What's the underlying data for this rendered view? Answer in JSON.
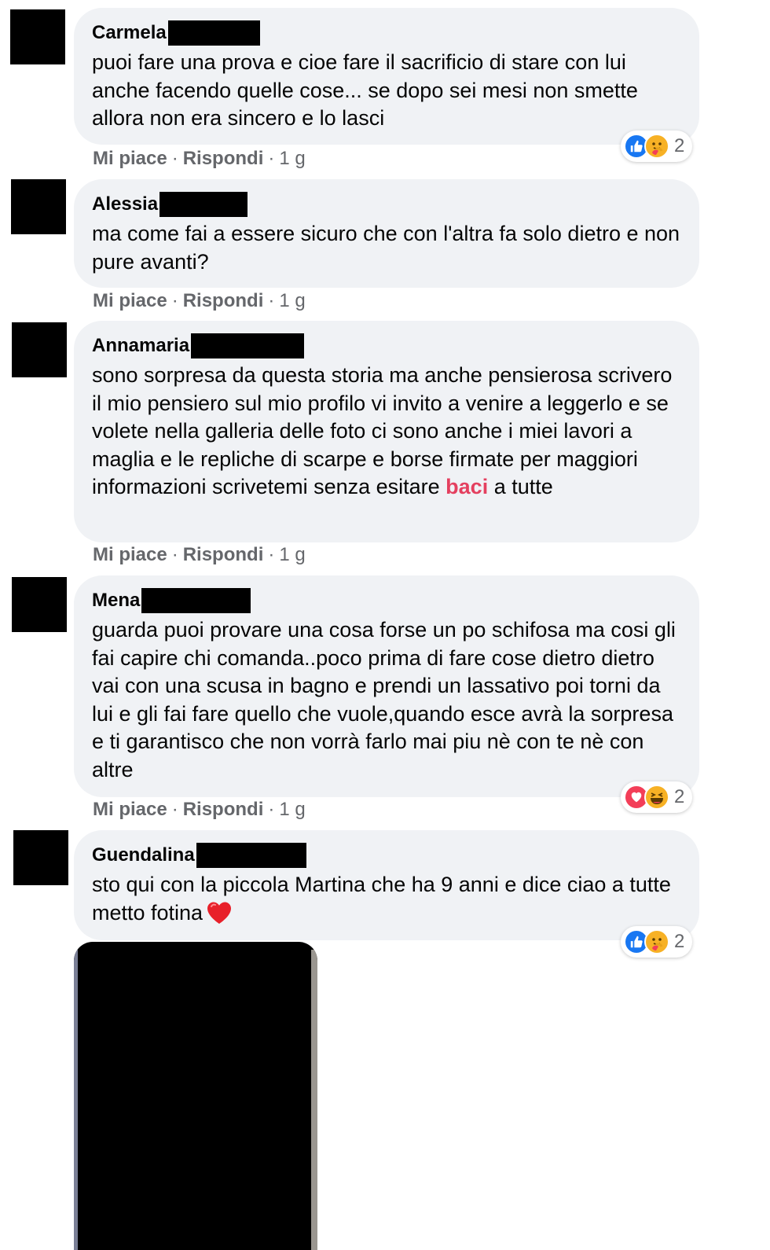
{
  "comments": [
    {
      "name": "Carmela",
      "text": "puoi fare una prova e cioe fare il sacrificio di stare con lui anche facendo quelle cose... se dopo sei mesi non smette allora non era sincero e lo lasci",
      "like_label": "Mi piace",
      "reply_label": "Rispondi",
      "time": "1 g",
      "reactions": {
        "icons": [
          "like-icon",
          "care-icon"
        ],
        "count": "2"
      }
    },
    {
      "name": "Alessia",
      "text": "ma come fai a essere sicuro che con l'altra fa solo dietro e non pure avanti?",
      "like_label": "Mi piace",
      "reply_label": "Rispondi",
      "time": "1 g"
    },
    {
      "name": "Annamaria",
      "text_before": "sono sorpresa da questa storia ma anche pensierosa scrivero il mio pensiero sul mio profilo vi invito a venire a leggerlo e se volete nella galleria delle foto ci sono anche i miei lavori a maglia e le repliche di scarpe e borse firmate per maggiori informazioni scrivetemi senza esitare ",
      "text_tag": "baci",
      "text_after": " a tutte",
      "like_label": "Mi piace",
      "reply_label": "Rispondi",
      "time": "1 g"
    },
    {
      "name": "Mena",
      "text": "guarda puoi provare una cosa forse un po schifosa ma cosi gli fai capire chi comanda..poco prima di fare cose dietro dietro vai con una scusa in bagno e prendi un lassativo poi torni da lui e gli fai fare quello che vuole,quando esce avrà la sorpresa e ti garantisco che non vorrà farlo mai piu nè con te nè con altre",
      "like_label": "Mi piace",
      "reply_label": "Rispondi",
      "time": "1 g",
      "reactions": {
        "icons": [
          "love-icon",
          "haha-icon"
        ],
        "count": "2"
      }
    },
    {
      "name": "Guendalina",
      "text": "sto qui con la piccola Martina che ha 9 anni e dice ciao a tutte metto fotina",
      "emoji": "red-heart-icon",
      "reactions": {
        "icons": [
          "like-icon",
          "care-icon"
        ],
        "count": "2"
      }
    }
  ],
  "colors": {
    "bubble": "#f0f2f5",
    "secondary_text": "#65676b",
    "like_blue": "#1877f2",
    "love_red": "#f33e58",
    "tag_pink": "#e4405f"
  }
}
